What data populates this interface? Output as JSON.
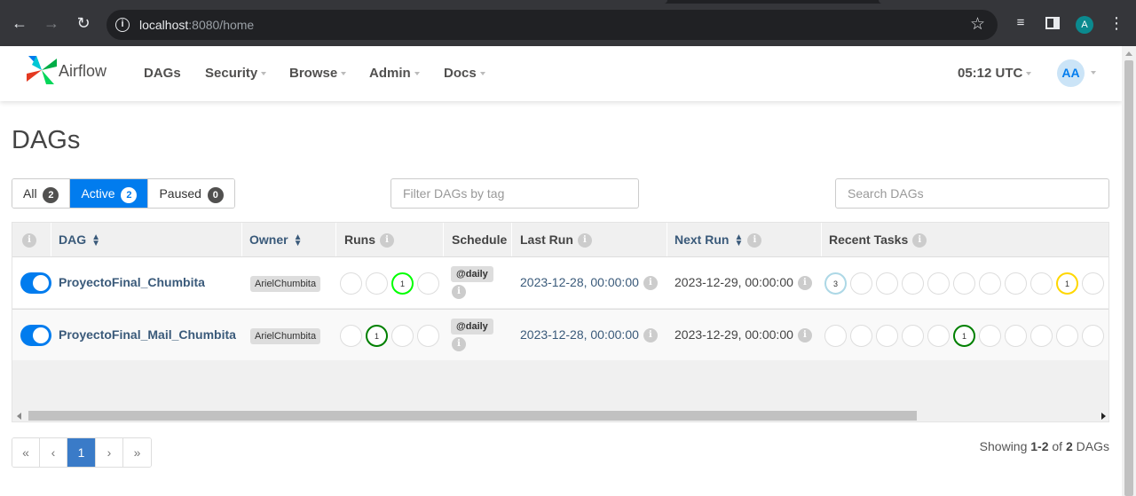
{
  "browser": {
    "url_host": "localhost",
    "url_path": ":8080/home",
    "profile_initial": "A"
  },
  "navbar": {
    "brand": "Airflow",
    "items": [
      "DAGs",
      "Security",
      "Browse",
      "Admin",
      "Docs"
    ],
    "clock": "05:12 UTC",
    "user_initials": "AA"
  },
  "page": {
    "title": "DAGs",
    "filters": [
      {
        "label": "All",
        "count": "2"
      },
      {
        "label": "Active",
        "count": "2"
      },
      {
        "label": "Paused",
        "count": "0"
      }
    ],
    "tag_filter_placeholder": "Filter DAGs by tag",
    "search_placeholder": "Search DAGs"
  },
  "table": {
    "headers": {
      "dag": "DAG",
      "owner": "Owner",
      "runs": "Runs",
      "schedule": "Schedule",
      "last_run": "Last Run",
      "next_run": "Next Run",
      "recent_tasks": "Recent Tasks"
    },
    "rows": [
      {
        "dag_id": "ProyectoFinal_Chumbita",
        "owner": "ArielChumbita",
        "schedule": "@daily",
        "last_run": "2023-12-28, 00:00:00",
        "next_run": "2023-12-29, 00:00:00",
        "runs": [
          "",
          "",
          "1",
          ""
        ],
        "tasks": [
          "3",
          "",
          "",
          "",
          "",
          "",
          "",
          "",
          "",
          "1",
          ""
        ]
      },
      {
        "dag_id": "ProyectoFinal_Mail_Chumbita",
        "owner": "ArielChumbita",
        "schedule": "@daily",
        "last_run": "2023-12-28, 00:00:00",
        "next_run": "2023-12-29, 00:00:00",
        "runs": [
          "",
          "1",
          "",
          ""
        ],
        "tasks": [
          "",
          "",
          "",
          "",
          "",
          "1",
          "",
          "",
          "",
          "",
          ""
        ]
      }
    ]
  },
  "status_colors": {
    "success": "#008000",
    "running": "#00ff00",
    "queued": "#808080",
    "scheduled": "#d2b48c",
    "upstream_failed": "#ffa500",
    "up_for_retry": "#ffd700",
    "removed": "#add8e6",
    "accent": "#017cee"
  },
  "pagination": {
    "first": "«",
    "prev": "‹",
    "current": "1",
    "next": "›",
    "last": "»"
  },
  "showing": {
    "prefix": "Showing",
    "range": "1-2",
    "of": "of",
    "total": "2",
    "suffix": "DAGs"
  }
}
